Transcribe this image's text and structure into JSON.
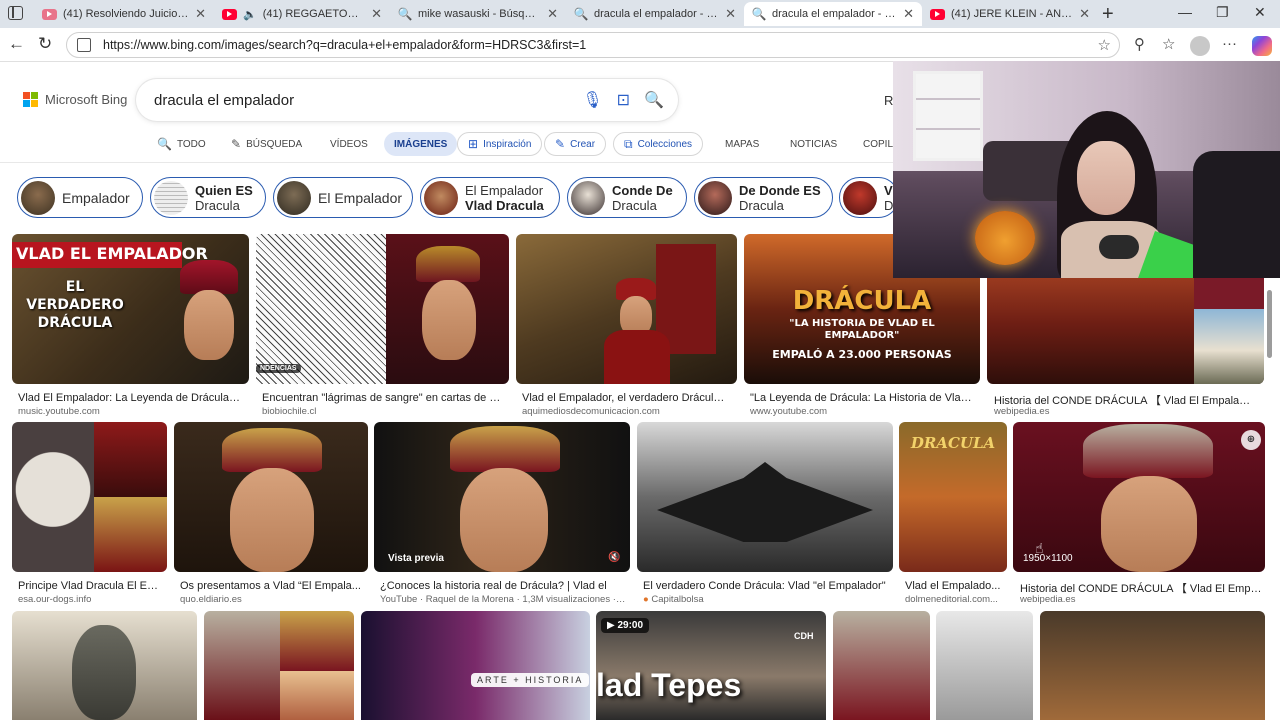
{
  "browser": {
    "tabs": [
      {
        "title": "(41) Resolviendo Juicios Abs",
        "favicon": "youtube-icon"
      },
      {
        "title": "(41) REGGAETON OLD S",
        "favicon": "youtube-icon"
      },
      {
        "title": "mike wasauski - Búsqueda",
        "favicon": "search-icon"
      },
      {
        "title": "dracula el empalador - Búsq",
        "favicon": "search-icon"
      },
      {
        "title": "dracula el empalador - Búsq",
        "favicon": "search-icon",
        "active": true
      },
      {
        "title": "(41) JERE KLEIN - ANDO (Vid",
        "favicon": "youtube-icon"
      }
    ],
    "url": "https://www.bing.com/images/search?q=dracula+el+empalador&form=HDRSC3&first=1"
  },
  "bing": {
    "logo_text": "Microsoft Bing",
    "query": "dracula el empalador",
    "rewards_initial": "R",
    "scopes": [
      {
        "label": "TODO",
        "icon": "search-icon"
      },
      {
        "label": "BÚSQUEDA",
        "icon": "copilot-icon"
      },
      {
        "label": "VÍDEOS"
      },
      {
        "label": "IMÁGENES",
        "active": true
      },
      {
        "label": "Inspiración",
        "icon": "inspiration-icon"
      },
      {
        "label": "Crear",
        "icon": "create-icon"
      },
      {
        "label": "Colecciones",
        "icon": "collections-icon"
      },
      {
        "label": "MAPAS"
      },
      {
        "label": "NOTICIAS"
      },
      {
        "label": "COPILO"
      }
    ],
    "chips": [
      {
        "line1": "Empalador"
      },
      {
        "line1": "Quien ES",
        "line2": "Dracula"
      },
      {
        "line1": "El Empalador"
      },
      {
        "line1": "El Empalador",
        "line2": "Vlad Dracula"
      },
      {
        "line1": "Conde De",
        "line2": "Dracula"
      },
      {
        "line1": "De Donde ES",
        "line2": "Dracula"
      },
      {
        "line1": "V",
        "line2": "D"
      }
    ]
  },
  "results": {
    "row1": [
      {
        "overlay1": "VLAD EL EMPALADOR",
        "overlay2": "EL VERDADERO DRÁCULA",
        "caption": "Vlad El Empalador: La Leyenda de Drácula - ...",
        "source": "music.youtube.com"
      },
      {
        "overlay": "NDENCIAS",
        "caption": "Encuentran \"lágrimas de sangre\" en cartas de Vl...",
        "source": "biobiochile.cl"
      },
      {
        "caption": "Vlad el Empalador, el verdadero Drácula ...",
        "source": "aquimediosdecomunicacion.com"
      },
      {
        "overlay1": "DRÁCULA",
        "overlay2": "\"LA HISTORIA DE VLAD EL EMPALADOR\"",
        "overlay3": "EMPALÓ A 23.000 PERSONAS",
        "caption": "\"La Leyenda de Drácula: La Historia de Vlad ...",
        "source": "www.youtube.com"
      },
      {
        "caption": "Historia del CONDE DRÁCULA 【 Vlad El Empalador",
        "source": "webipedia.es"
      }
    ],
    "row2": [
      {
        "caption": "Principe Vlad Dracula El Em...",
        "source": "esa.our-dogs.info"
      },
      {
        "caption": "Os presentamos a Vlad “El Empala...",
        "source": "quo.eldiario.es"
      },
      {
        "badge": "Vista previa",
        "caption": "¿Conoces la historia real de Drácula? | Vlad el",
        "source": "YouTube · Raquel de la Morena · 1,3M visualizaciones · 15..."
      },
      {
        "caption": "El verdadero Conde Drácula: Vlad \"el Empalador\"",
        "source": "Capitalbolsa"
      },
      {
        "overlay": "DRACULA",
        "caption": "Vlad el Empalado...",
        "source": "dolmeneditorial.com..."
      },
      {
        "dimensions": "1950×1100",
        "caption": "Historia del CONDE DRÁCULA 【 Vlad El Empala...",
        "source": "webipedia.es"
      }
    ],
    "row3": [
      {
        "overlay": "ARTE + HISTORIA"
      },
      {
        "duration": "29:00",
        "overlay": "lad Tepes",
        "logo": "CDH"
      }
    ]
  }
}
